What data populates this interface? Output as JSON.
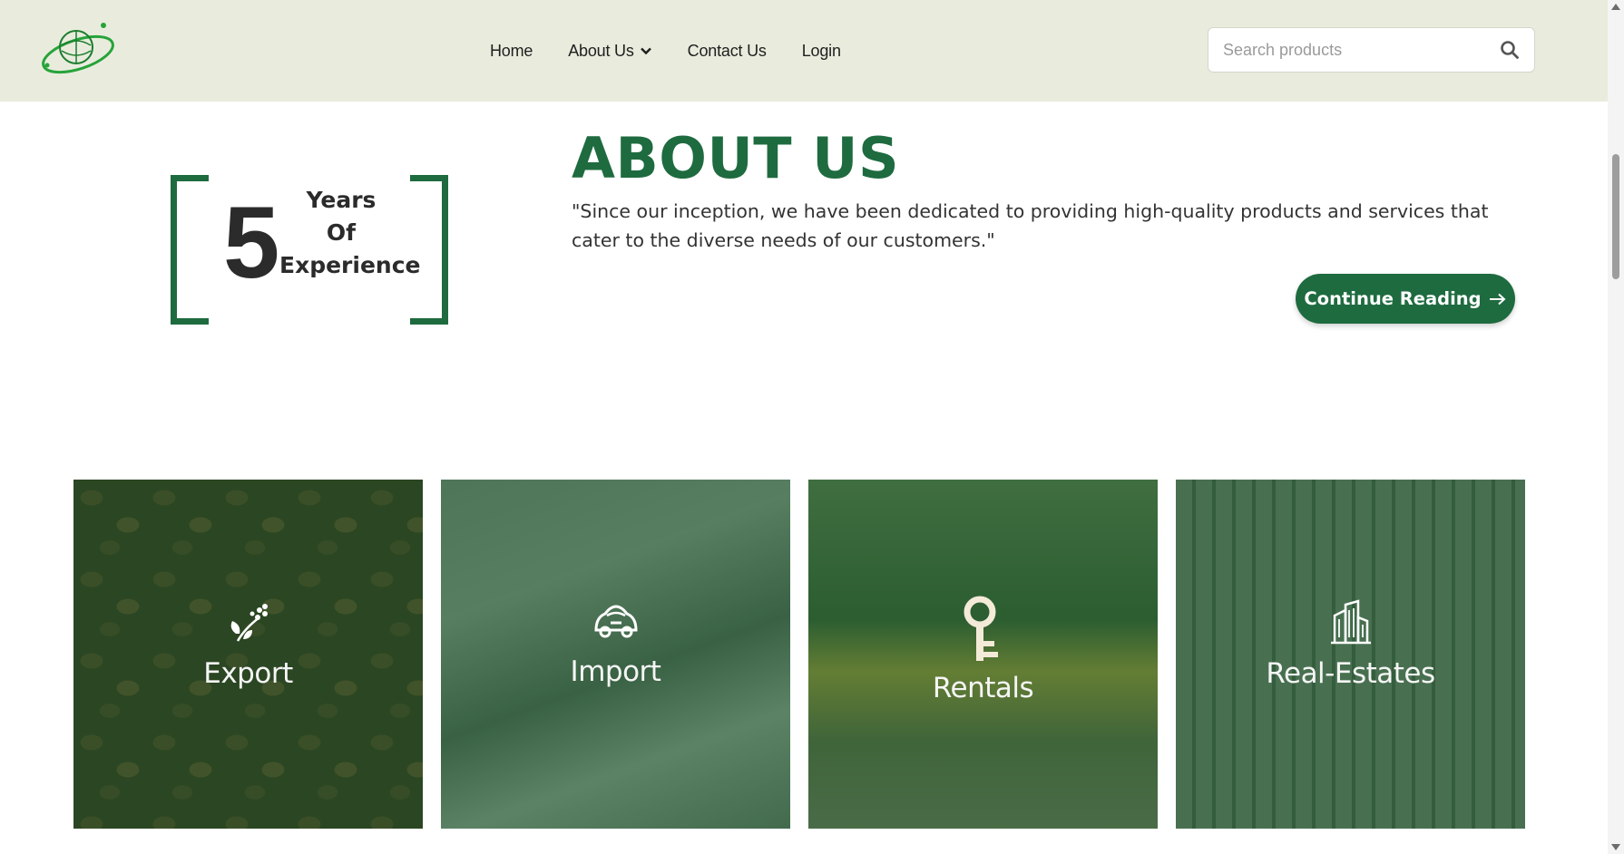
{
  "header": {
    "nav": {
      "home": "Home",
      "about": "About Us",
      "contact": "Contact Us",
      "login": "Login"
    },
    "search": {
      "placeholder": "Search products"
    }
  },
  "experience": {
    "number": "5",
    "line1": "Years",
    "line2": "Of",
    "line3": "Experience"
  },
  "about": {
    "title": "ABOUT US",
    "quote": "\"Since our inception, we have been dedicated to providing high-quality products and services that cater to the diverse needs of our customers.\"",
    "cta": "Continue Reading"
  },
  "cards": [
    {
      "label": "Export",
      "icon": "coffee-plant-icon"
    },
    {
      "label": "Import",
      "icon": "car-icon"
    },
    {
      "label": "Rentals",
      "icon": "key-icon"
    },
    {
      "label": "Real-Estates",
      "icon": "buildings-icon"
    }
  ],
  "colors": {
    "brand_green": "#1e6b3f",
    "header_bg": "#e9ecdd"
  }
}
